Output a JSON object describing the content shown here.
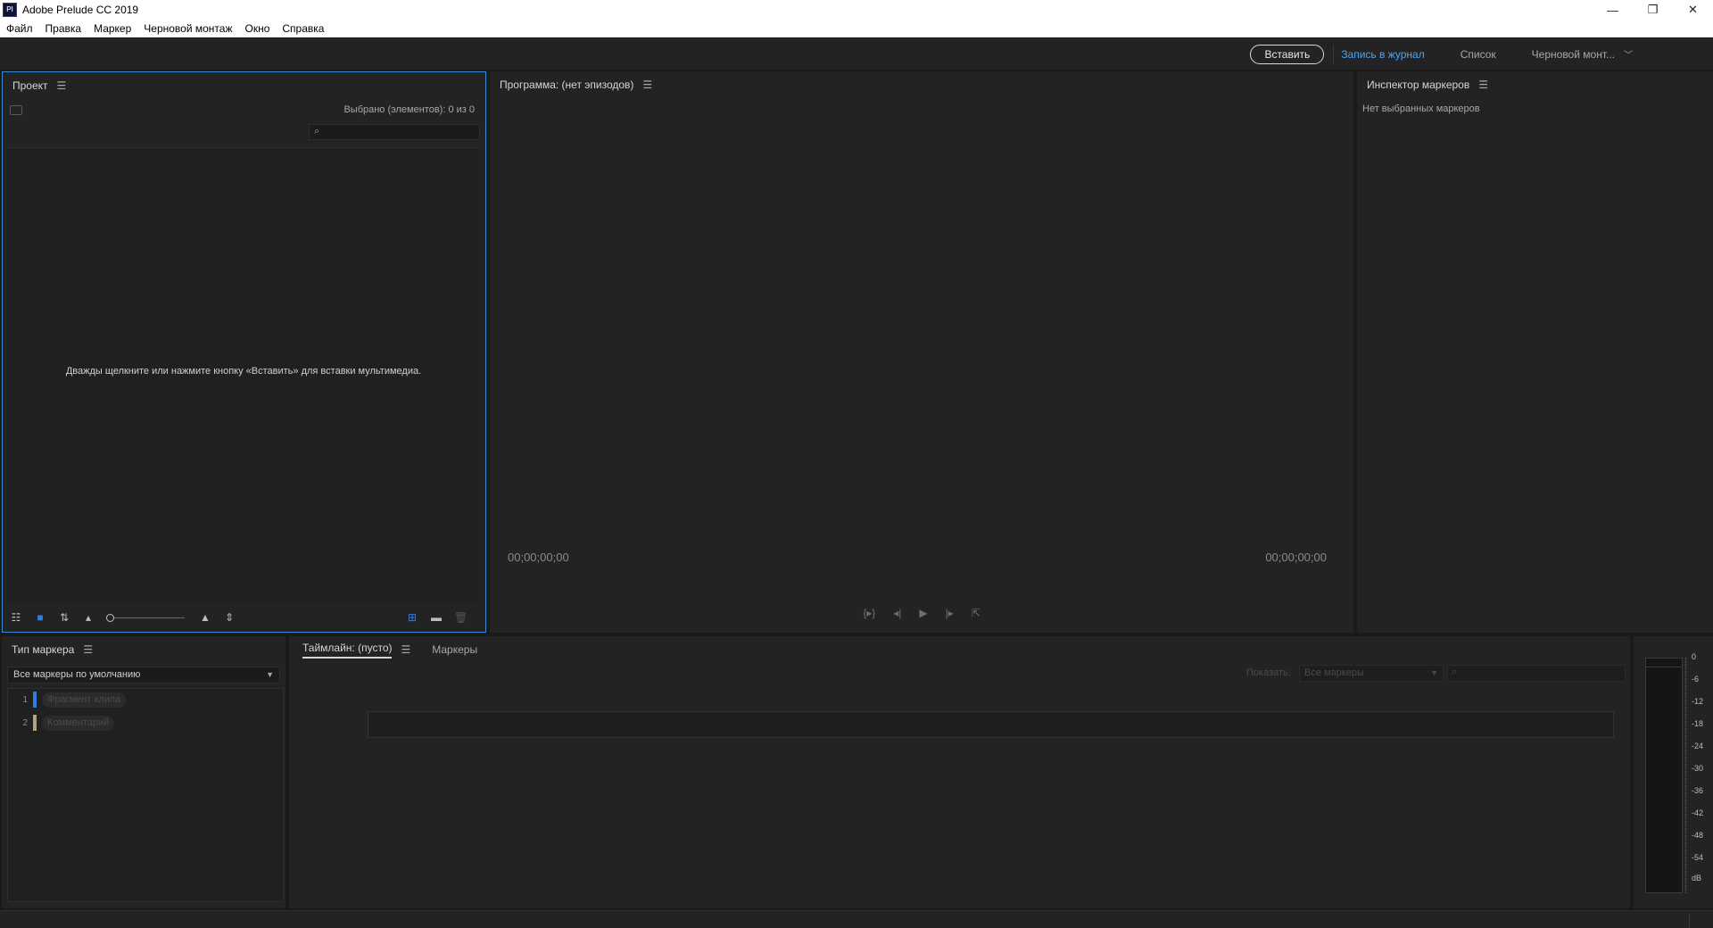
{
  "window": {
    "title": "Adobe Prelude CC 2019",
    "icon_text": "Pl",
    "controls": {
      "minimize": "—",
      "restore": "❐",
      "close": "✕"
    }
  },
  "menu": [
    "Файл",
    "Правка",
    "Маркер",
    "Черновой монтаж",
    "Окно",
    "Справка"
  ],
  "workspace": {
    "import_label": "Вставить",
    "items": [
      "Запись в журнал",
      "Список",
      "Черновой монт..."
    ],
    "active_color": "#4aa3ff"
  },
  "project_panel": {
    "title": "Проект",
    "selected_text": "Выбрано (элементов): 0 из 0",
    "search_placeholder": "",
    "empty_message": "Дважды щелкните или нажмите кнопку «Вставить» для вставки мультимедиа.",
    "accent_color": "#3a8ad8"
  },
  "program_panel": {
    "title": "Программа: (нет эпизодов)",
    "timecode_in": "00;00;00;00",
    "timecode_out": "00;00;00;00"
  },
  "inspector_panel": {
    "title": "Инспектор маркеров",
    "empty_message": "Нет выбранных маркеров"
  },
  "marker_type_panel": {
    "title": "Тип маркера",
    "selected_option": "Все маркеры по умолчанию",
    "items": [
      {
        "num": "1",
        "label": "Фрагмент клипа",
        "color": "#2f7fe0"
      },
      {
        "num": "2",
        "label": "Комментарий",
        "color": "#b8a27a"
      }
    ]
  },
  "timeline_panel": {
    "tab_active": "Таймлайн: (пусто)",
    "tab_markers": "Маркеры",
    "show_label": "Показать:",
    "filter_value": "Все маркеры"
  },
  "audio_meter": {
    "ticks": [
      "0",
      "-6",
      "-12",
      "-18",
      "-24",
      "-30",
      "-36",
      "-42",
      "-48",
      "-54",
      "dB"
    ]
  }
}
